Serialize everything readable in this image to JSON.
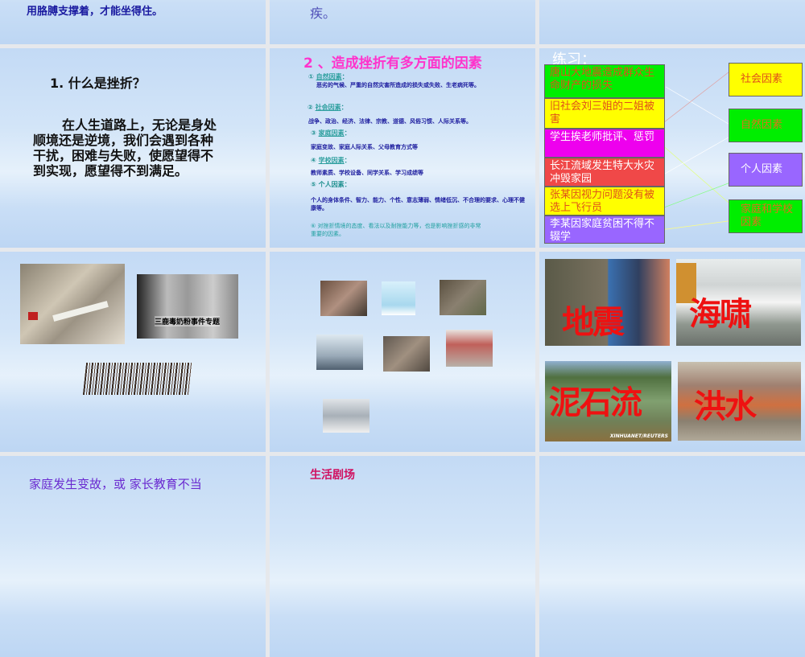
{
  "slides": {
    "top_left": {
      "text": "用胳膊支撑着，才能坐得住。"
    },
    "top_middle": {
      "text": "疾。"
    },
    "what_is_frustration": {
      "title": "1.   什么是挫折？",
      "body": "在人生道路上，无论是身处顺境还是逆境，我们会遇到各种干扰，困难与失败，使愿望得不到实现，愿望得不到满足。"
    },
    "factors": {
      "title": "2 、造成挫折有多方面的因素",
      "items": [
        {
          "num": "①",
          "heading": "自然因素",
          "desc": "恶劣的气候、严重的自然灾害所造成的损失或失败、生老病死等。"
        },
        {
          "num": "②",
          "heading": "社会因素",
          "desc": "战争、政治、经济、法律、宗教、道德、风俗习惯、人际关系等。"
        },
        {
          "num": "③",
          "heading": "家庭因素",
          "desc": "家庭变故、家庭人际关系、父母教育方式等"
        },
        {
          "num": "④",
          "heading": "学校因素",
          "desc": "教师素质、学校设备、同学关系、学习成绩等"
        },
        {
          "num": "⑤",
          "heading": "个人因素",
          "desc": "个人的身体条件、智力、能力、个性、意志薄弱、情绪低沉、不合理的要求、心理不健康等。"
        },
        {
          "num": "⑥",
          "heading": "",
          "desc": "对挫折情境的态度、看法以及耐挫能力等，也是影响挫折感的非常重要的因素。"
        }
      ]
    },
    "exercise": {
      "title": "练习：",
      "left": [
        {
          "text": "唐山大地震造成群众生命财产的损失",
          "bg": "#00ee00",
          "color": "#e0501a"
        },
        {
          "text": "旧社会刘三姐的二姐被害",
          "bg": "#ffff00",
          "color": "#e0501a"
        },
        {
          "text": "学生挨老师批评、惩罚",
          "bg": "#ee00ee",
          "color": "#ffffff"
        },
        {
          "text": "长江流域发生特大水灾冲毁家园",
          "bg": "#f04848",
          "color": "#ffffff"
        },
        {
          "text": "张某因视力问题没有被选上飞行员",
          "bg": "#ffff00",
          "color": "#e0501a"
        },
        {
          "text": "李某因家庭贫困不得不辍学",
          "bg": "#9966ff",
          "color": "#ffffff"
        }
      ],
      "right": [
        {
          "text": "社会因素",
          "bg": "#ffff00",
          "color": "#e0501a"
        },
        {
          "text": "自然因素",
          "bg": "#00ee00",
          "color": "#e0701a"
        },
        {
          "text": "个人因素",
          "bg": "#9966ff",
          "color": "#ffffff"
        },
        {
          "text": "家庭和学校因素",
          "bg": "#00ee00",
          "color": "#e0701a"
        }
      ]
    },
    "events": {
      "caption": "三鹿毒奶粉事件专题"
    },
    "disasters": {
      "labels": [
        "地震",
        "海啸",
        "泥石流",
        "洪水"
      ],
      "credit": "XINHUANET/REUTERS"
    },
    "bottom_left": {
      "text": "家庭发生变故，或 家长教育不当"
    },
    "bottom_middle": {
      "title": "生活剧场"
    }
  }
}
